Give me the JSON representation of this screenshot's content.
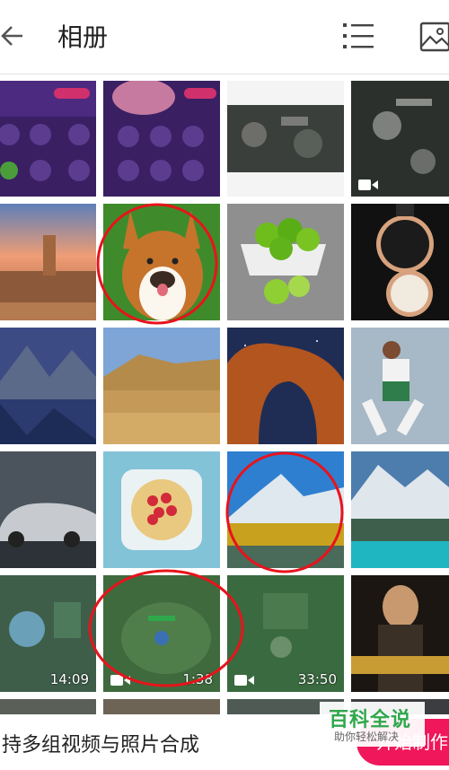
{
  "header": {
    "title": "相册",
    "back_icon": "arrow-left-icon",
    "list_icon": "list-view-icon",
    "gallery_icon": "gallery-icon"
  },
  "grid": {
    "video_durations": [
      "14:09",
      "1:38",
      "33:50"
    ],
    "video_badge_icon": "video-camera-icon",
    "annotation_color": "#e8131b"
  },
  "footer": {
    "text": "持多组视频与照片合成",
    "cta_label": "开始制作",
    "cta_color": "#f0175a"
  },
  "watermark": {
    "title": "百科全说",
    "subtitle": "助你轻松解决",
    "color": "#2fa84b"
  }
}
